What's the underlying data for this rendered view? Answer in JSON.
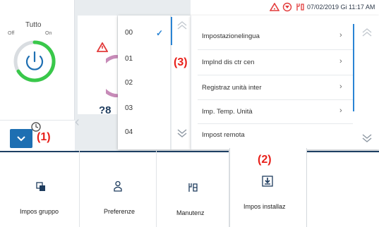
{
  "status": {
    "datetime": "07/02/2019 Gi 11:17 AM",
    "icons": [
      "warning-triangle-icon",
      "shield-filter-icon",
      "service-tools-icon"
    ]
  },
  "power": {
    "title": "Tutto",
    "off_label": "Off",
    "on_label": "On",
    "accent": "#39c84a",
    "icon": "power-icon"
  },
  "callouts": {
    "c1": "(1)",
    "c2": "(2)",
    "c3": "(3)"
  },
  "picker": {
    "options": [
      "00",
      "01",
      "02",
      "03",
      "04"
    ],
    "selected": "00"
  },
  "settings": {
    "items": [
      "Impostazionelingua",
      "Implnd dis ctr cen",
      "Registraz unità inter",
      "Imp. Temp. Unità",
      "Impost remota"
    ]
  },
  "bg": {
    "help_label": "?8"
  },
  "bottom_tabs": [
    {
      "label": "Impos gruppo",
      "icon": "group-settings-icon"
    },
    {
      "label": "Preferenze",
      "icon": "preferences-icon"
    },
    {
      "label": "Manutenz",
      "icon": "maintenance-icon"
    },
    {
      "label": "Impos installaz",
      "icon": "installation-settings-icon"
    }
  ],
  "colors": {
    "accent_blue": "#1e6fb2",
    "warning_red": "#e23b3b",
    "callout_red": "#e8201a",
    "bottom_border": "#1d3f63"
  }
}
